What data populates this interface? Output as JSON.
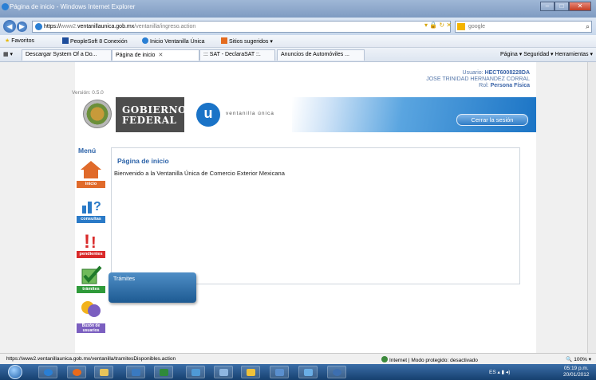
{
  "window": {
    "title": "Página de inicio - Windows Internet Explorer",
    "buttons": {
      "minimize": "–",
      "maximize": "□",
      "close": "✕"
    }
  },
  "address_bar": {
    "back": "◀",
    "forward": "▶",
    "url_prefix": "https://",
    "url_gray1": "www2.",
    "url_host": "ventanillaunica.gob.mx",
    "url_gray2": "/ventanilla/ingreso.action",
    "tools": "▾ 🔒 ↻ ✕",
    "search_placeholder": "google",
    "search_icon": "⌕"
  },
  "favorites_bar": {
    "favorites_label": "Favoritos",
    "items": [
      "PeopleSoft 8 Conexión",
      "Inicio Ventanilla Única",
      "Sitios sugeridos ▾"
    ]
  },
  "tabs": {
    "items": [
      "Descargar System Of a Do...",
      "Página de inicio",
      "::: SAT - DeclaraSAT ::.",
      "Anuncios de Automóviles ..."
    ],
    "close_glyph": "✕",
    "command_bar": "Página ▾  Seguridad ▾  Herramientas ▾"
  },
  "page": {
    "user_line": "Usuario:",
    "user_id": "HECT6008228DA",
    "user_name": "JOSE TRINIDAD HERNANDEZ CORRAL",
    "role_label": "Rol:",
    "role": "Persona Física",
    "version": "Versión: 0.5.0",
    "gobierno_line1": "GOBIERNO",
    "gobierno_line2": "FEDERAL",
    "vu_letter": "u",
    "vu_text": "ventanilla única",
    "logout_label": "Cerrar la sesión",
    "menu_title": "Menú",
    "menu_items": [
      {
        "label": "inicio",
        "color": "#e06a2a"
      },
      {
        "label": "consultas",
        "color": "#2a7ac7"
      },
      {
        "label": "pendientes",
        "color": "#d92a2a"
      },
      {
        "label": "trámites",
        "color": "#2f9a3a"
      },
      {
        "label": "Buzón de usuarios",
        "color": "#7b5fc0"
      }
    ],
    "panel_title": "Página de inicio",
    "panel_text": "Bienvenido a la Ventanilla Única de Comercio Exterior Mexicana",
    "tooltip": "Trámites"
  },
  "status_bar": {
    "url": "https://www2.ventanillaunica.gob.mx/ventanilla/tramitesDisponibles.action",
    "zone": "Internet | Modo protegido: desactivado",
    "zoom": "100%"
  },
  "taskbar": {
    "tray": "ES",
    "time": "05:19 p.m.",
    "date": "20/01/2012"
  }
}
